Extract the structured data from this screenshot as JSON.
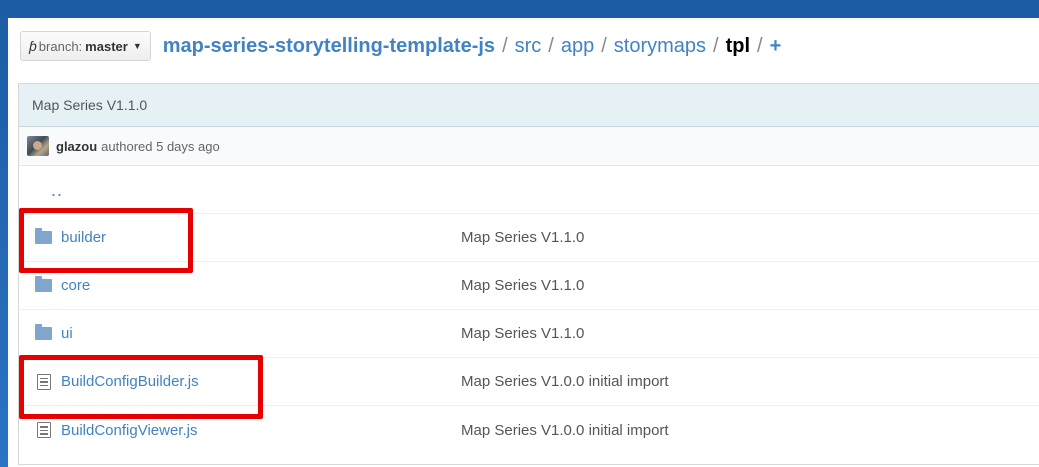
{
  "breadcrumb": {
    "branch_prefix": "branch:",
    "branch_name": "master",
    "repo": "map-series-storytelling-template-js",
    "sep": "/",
    "path": [
      "src",
      "app",
      "storymaps"
    ],
    "current": "tpl",
    "add": "+"
  },
  "commit": {
    "title": "Map Series V1.1.0",
    "author": "glazou",
    "authored_text": "authored 5 days ago"
  },
  "up_dir": "..",
  "files": [
    {
      "type": "folder",
      "name": "builder",
      "message": "Map Series V1.1.0"
    },
    {
      "type": "folder",
      "name": "core",
      "message": "Map Series V1.1.0"
    },
    {
      "type": "folder",
      "name": "ui",
      "message": "Map Series V1.1.0"
    },
    {
      "type": "file",
      "name": "BuildConfigBuilder.js",
      "message": "Map Series V1.0.0 initial import"
    },
    {
      "type": "file",
      "name": "BuildConfigViewer.js",
      "message": "Map Series V1.0.0 initial import"
    }
  ],
  "highlighted_items": [
    "builder",
    "BuildConfigBuilder.js"
  ],
  "colors": {
    "link": "#4183c4",
    "highlight": "#e60000",
    "commit_bar": "#e6f1f6",
    "frame": "#1a5fa8"
  }
}
